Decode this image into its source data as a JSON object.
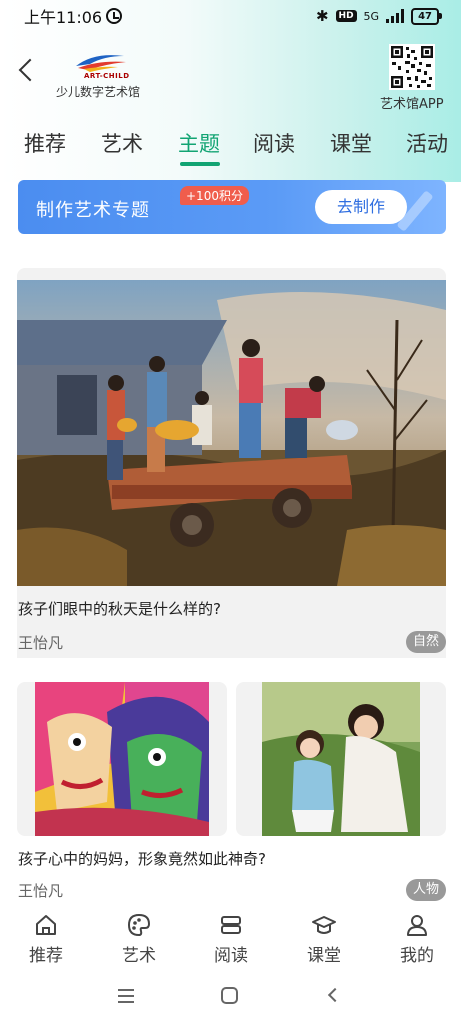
{
  "status_bar": {
    "time": "上午11:06",
    "network": "5G",
    "battery": "47"
  },
  "header": {
    "logo_brand": "ART-CHILD",
    "logo_name": "少儿数字艺术馆",
    "qr_label": "艺术馆APP"
  },
  "tabs": [
    {
      "label": "推荐"
    },
    {
      "label": "艺术"
    },
    {
      "label": "主题"
    },
    {
      "label": "阅读"
    },
    {
      "label": "课堂"
    },
    {
      "label": "活动"
    }
  ],
  "active_tab": "主题",
  "banner": {
    "text": "制作艺术专题",
    "badge": "+100积分",
    "button": "去制作"
  },
  "feed": [
    {
      "title": "孩子们眼中的秋天是什么样的?",
      "author": "王怡凡",
      "tag": "自然"
    },
    {
      "title": "孩子心中的妈妈，形象竟然如此神奇?",
      "author": "王怡凡",
      "tag": "人物"
    }
  ],
  "bottom_nav": [
    {
      "label": "推荐",
      "icon": "home-icon"
    },
    {
      "label": "艺术",
      "icon": "palette-icon"
    },
    {
      "label": "阅读",
      "icon": "book-icon"
    },
    {
      "label": "课堂",
      "icon": "graduation-cap-icon"
    },
    {
      "label": "我的",
      "icon": "user-icon"
    }
  ],
  "colors": {
    "accent": "#12a473",
    "banner_blue": "#4b8df0",
    "badge_red": "#f05d4c",
    "tag_gray": "#999999"
  }
}
